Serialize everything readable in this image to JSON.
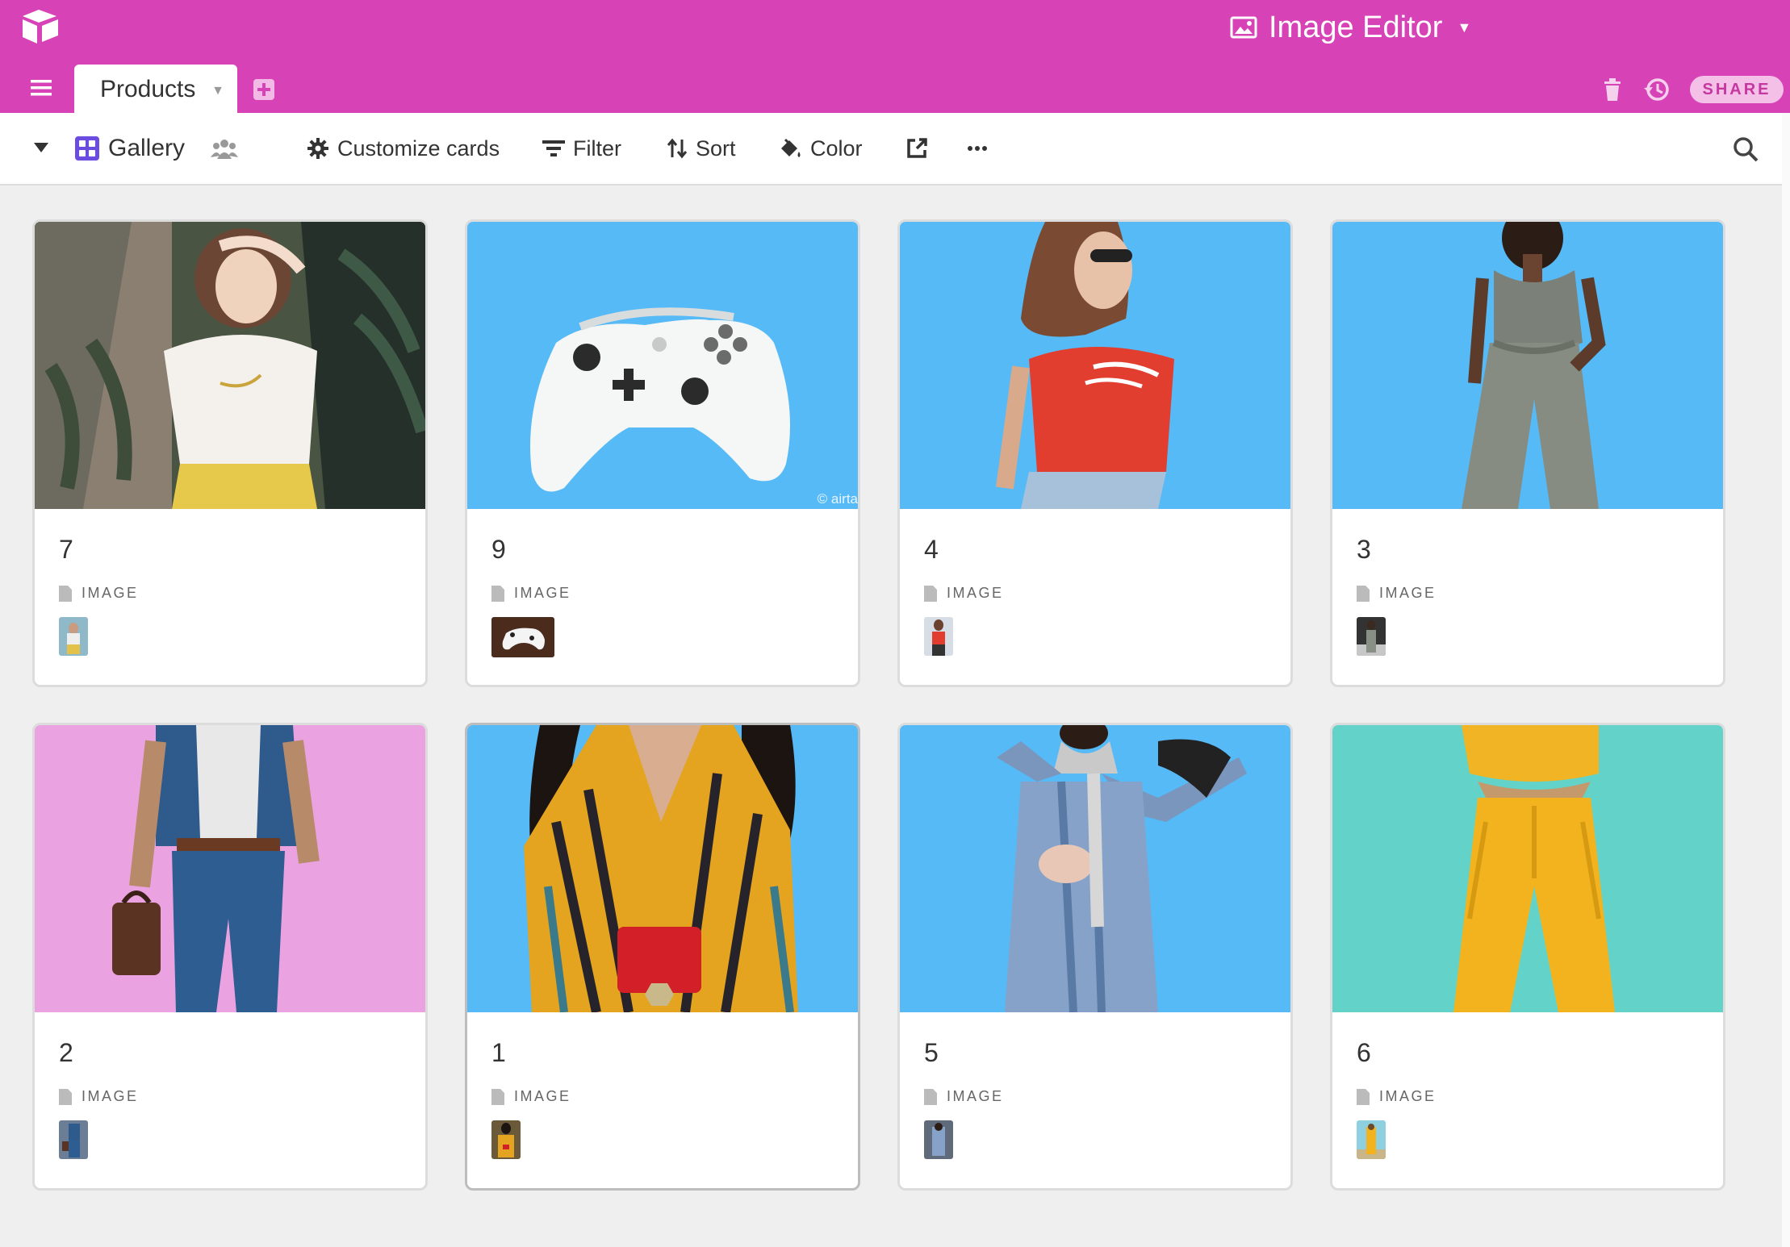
{
  "header": {
    "base_name": "Image Editor",
    "table_tab": "Products",
    "share_label": "SHARE"
  },
  "viewbar": {
    "view_name": "Gallery",
    "customize_label": "Customize cards",
    "filter_label": "Filter",
    "sort_label": "Sort",
    "color_label": "Color"
  },
  "colors": {
    "brand": "#d742b6",
    "sky": "#56baf7",
    "pink": "#eaa3e0",
    "teal": "#63d3c9"
  },
  "cards": [
    {
      "title": "7",
      "field_label": "IMAGE",
      "bg": "photo-dark"
    },
    {
      "title": "9",
      "field_label": "IMAGE",
      "bg": "#56baf7",
      "copyright": "© airta"
    },
    {
      "title": "4",
      "field_label": "IMAGE",
      "bg": "#56baf7"
    },
    {
      "title": "3",
      "field_label": "IMAGE",
      "bg": "#56baf7"
    },
    {
      "title": "2",
      "field_label": "IMAGE",
      "bg": "#eaa3e0"
    },
    {
      "title": "1",
      "field_label": "IMAGE",
      "bg": "#56baf7"
    },
    {
      "title": "5",
      "field_label": "IMAGE",
      "bg": "#56baf7"
    },
    {
      "title": "6",
      "field_label": "IMAGE",
      "bg": "#63d3c9"
    }
  ]
}
